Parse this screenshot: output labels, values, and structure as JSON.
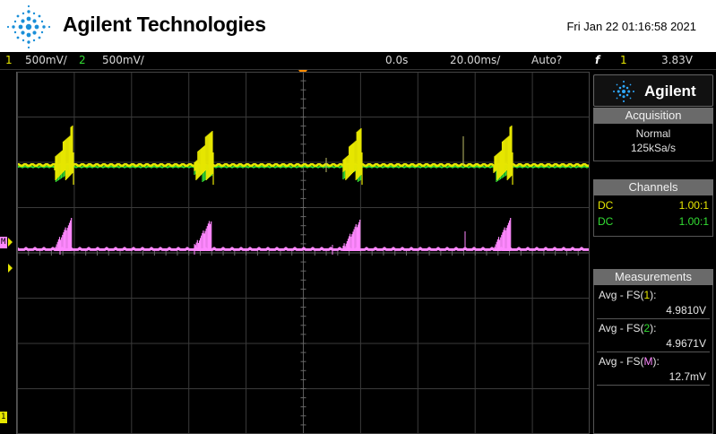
{
  "header": {
    "brand": "Agilent Technologies",
    "datetime": "Fri Jan 22 01:16:58 2021"
  },
  "status": {
    "ch1_num": "1",
    "ch1_scale": "500mV/",
    "ch2_num": "2",
    "ch2_scale": "500mV/",
    "time_delay": "0.0s",
    "time_scale": "20.00ms/",
    "trigger_mode": "Auto?",
    "trigger_icon": "f",
    "trigger_source": "1",
    "trigger_level": "3.83V"
  },
  "markers": {
    "ch1": "1",
    "math": "M",
    "ground": "1"
  },
  "panel": {
    "brand": "Agilent",
    "acquisition": {
      "title": "Acquisition",
      "mode": "Normal",
      "rate": "125kSa/s"
    },
    "channels": {
      "title": "Channels",
      "rows": [
        {
          "coupling": "DC",
          "probe": "1.00:1"
        },
        {
          "coupling": "DC",
          "probe": "1.00:1"
        }
      ]
    },
    "measurements": {
      "title": "Measurements",
      "items": [
        {
          "prefix": "Avg - FS(",
          "src": "1",
          "suffix": "):",
          "value": "4.9810V",
          "color": "#e6e600"
        },
        {
          "prefix": "Avg - FS(",
          "src": "2",
          "suffix": "):",
          "value": "4.9671V",
          "color": "#33dd33"
        },
        {
          "prefix": "Avg - FS(",
          "src": "M",
          "suffix": "):",
          "value": "12.7mV",
          "color": "#ff88ff"
        }
      ]
    }
  },
  "colors": {
    "ch1": "#e6e600",
    "ch2": "#33dd33",
    "math": "#ff88ff",
    "trigger": "#ff8c00"
  }
}
